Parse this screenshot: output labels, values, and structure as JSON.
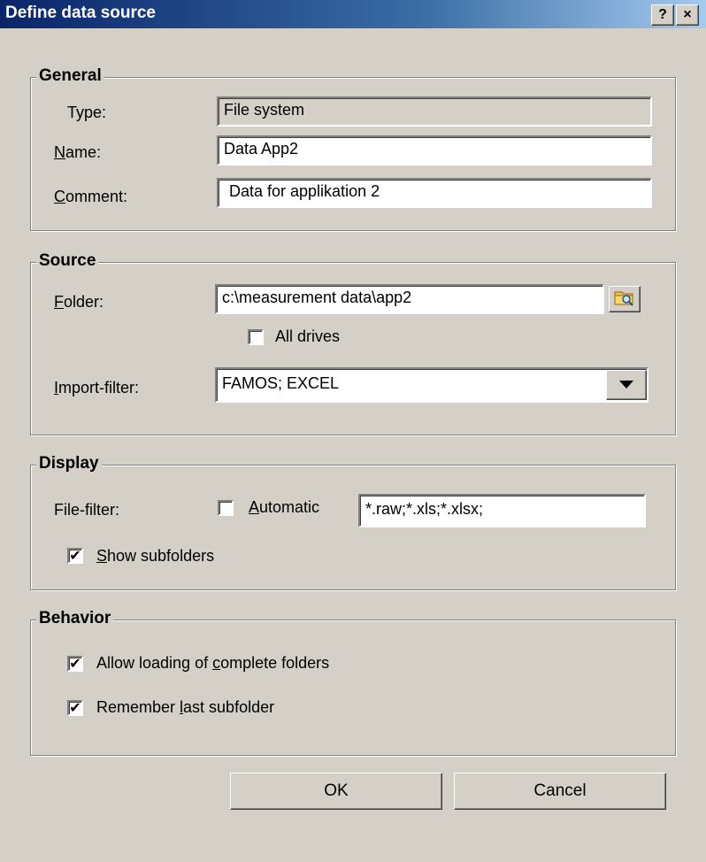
{
  "window": {
    "title": "Define data source",
    "help_label": "?",
    "close_label": "×"
  },
  "general": {
    "title": "General",
    "type_label": "Type:",
    "type_value": "File system",
    "name_label": "Name:",
    "name_value": "Data App2",
    "comment_label": "Comment:",
    "comment_value": "Data for applikation 2"
  },
  "source": {
    "title": "Source",
    "folder_label": "Folder:",
    "folder_value": "c:\\measurement data\\app2",
    "all_drives_label": "All drives",
    "all_drives_checked": false,
    "import_filter_label": "Import-filter:",
    "import_filter_value": "FAMOS; EXCEL"
  },
  "display": {
    "title": "Display",
    "file_filter_label": "File-filter:",
    "automatic_label": "Automatic",
    "automatic_checked": false,
    "file_filter_value": "*.raw;*.xls;*.xlsx;",
    "show_subfolders_label": "Show subfolders",
    "show_subfolders_checked": true
  },
  "behavior": {
    "title": "Behavior",
    "allow_loading_label": "Allow loading of complete folders",
    "allow_loading_checked": true,
    "remember_label": "Remember last subfolder",
    "remember_checked": true
  },
  "buttons": {
    "ok": "OK",
    "cancel": "Cancel"
  },
  "icons": {
    "browse": "folder-search-icon",
    "dropdown": "triangle-down-icon",
    "check": "checkmark"
  }
}
